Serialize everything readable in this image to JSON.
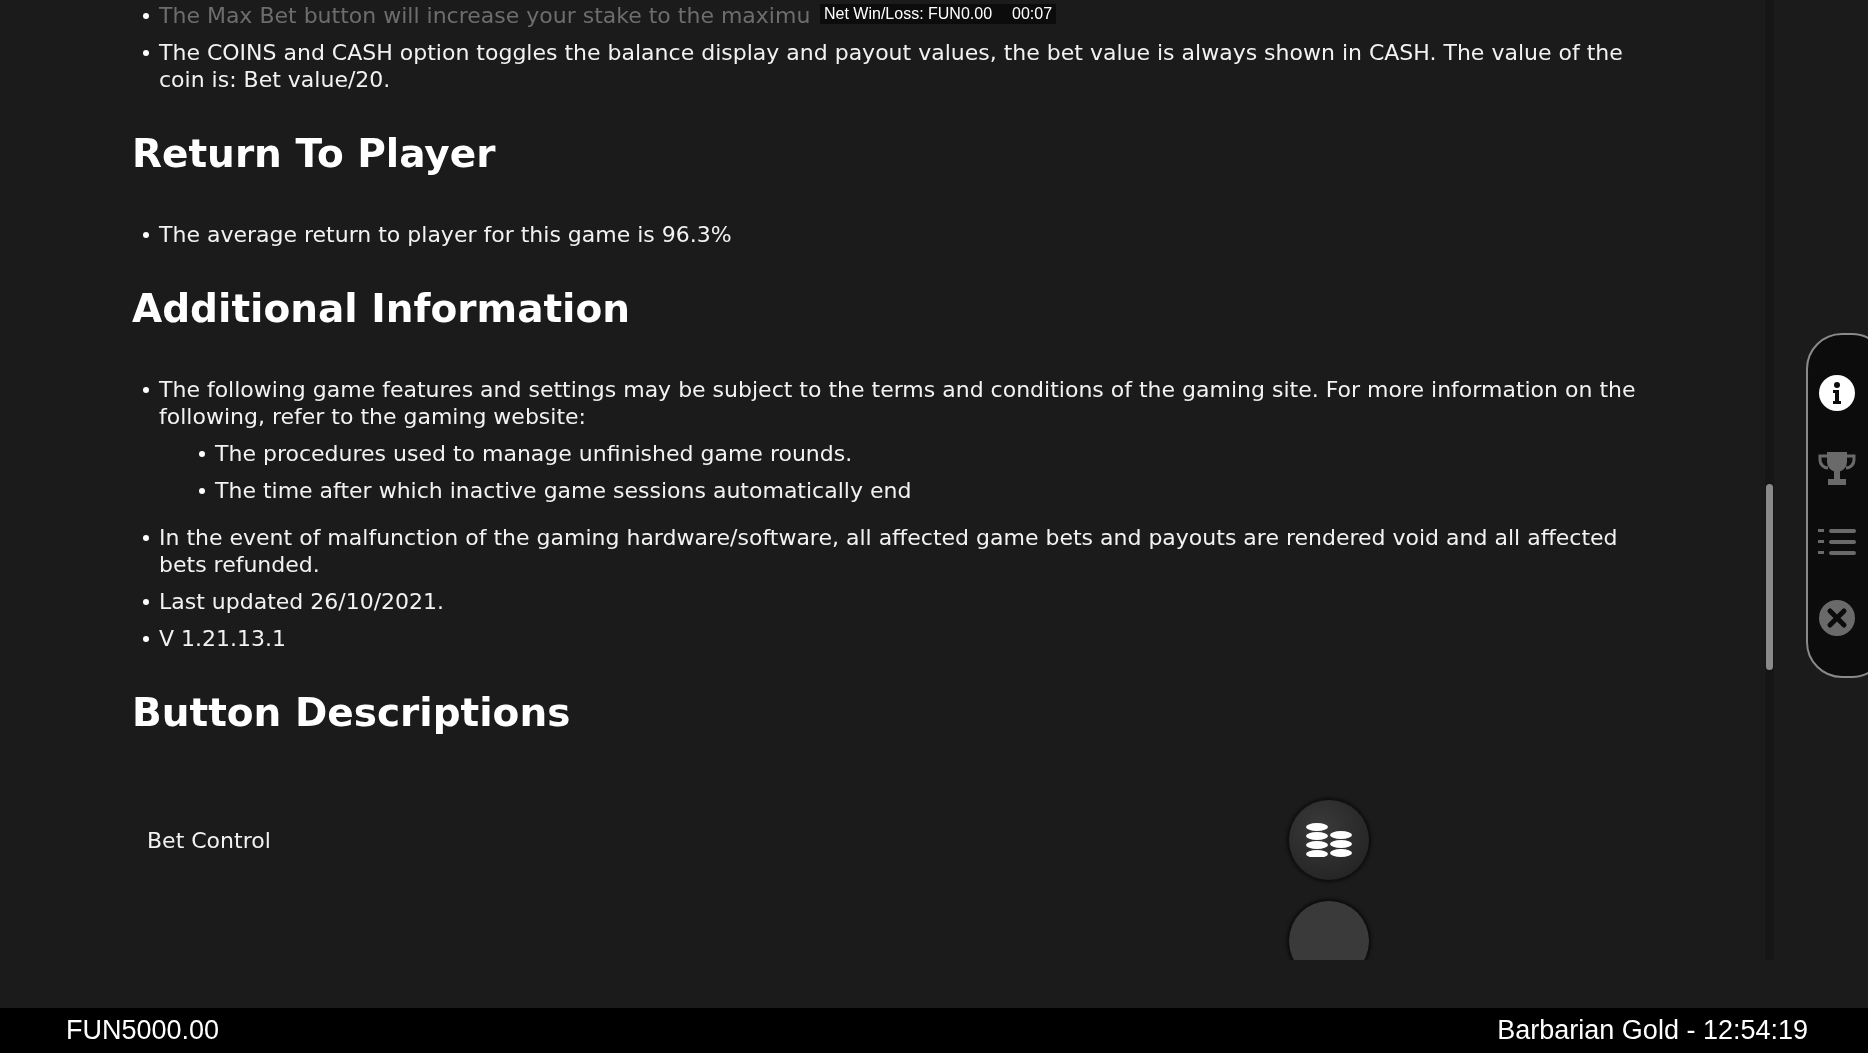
{
  "overlay": {
    "net": "Net Win/Loss: FUN0.00",
    "timer": "00:07"
  },
  "intro_list": [
    {
      "text": "The Max Bet button will increase your stake to the maximu",
      "faded": true
    },
    {
      "text": "The COINS and CASH option toggles the balance display and payout values, the bet value is always shown in CASH. The value of the coin is: Bet value/20.",
      "faded": false
    }
  ],
  "sections": [
    {
      "heading": "Return To Player",
      "items": [
        {
          "text": "The average return to player for this game is 96.3%"
        }
      ]
    },
    {
      "heading": "Additional Information",
      "items": [
        {
          "text": "The following game features and settings may be subject to the terms and conditions of the gaming site. For more information on the following, refer to the gaming website:",
          "children": [
            {
              "text": "The procedures used to manage unfinished game rounds."
            },
            {
              "text": "The time after which inactive game sessions automatically end"
            }
          ]
        },
        {
          "text": "In the event of malfunction of the gaming hardware/software, all affected game bets and payouts are rendered void and all affected bets refunded."
        },
        {
          "text": "Last updated 26/10/2021."
        },
        {
          "text": "V 1.21.13.1"
        }
      ]
    }
  ],
  "button_descriptions": {
    "heading": "Button Descriptions",
    "rows": [
      {
        "label": "Bet Control",
        "kind": "coins"
      },
      {
        "kind": "partial"
      }
    ]
  },
  "side_menu": [
    {
      "kind": "info",
      "selected": true
    },
    {
      "kind": "trophy",
      "selected": false
    },
    {
      "kind": "ranking",
      "selected": false
    },
    {
      "kind": "close",
      "selected": false
    }
  ],
  "footer": {
    "balance": "FUN5000.00",
    "game": "Barbarian Gold - 12:54:19"
  }
}
